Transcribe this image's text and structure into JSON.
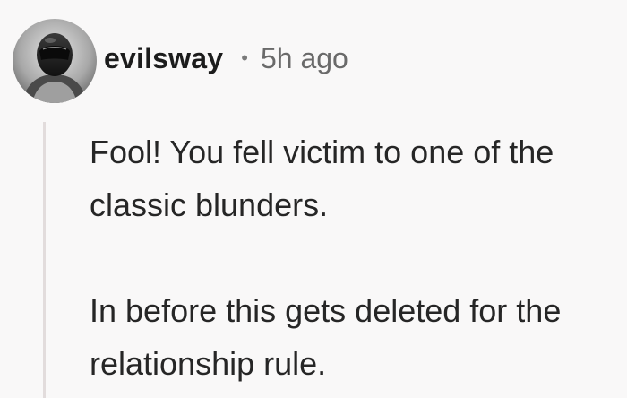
{
  "comment": {
    "username": "evilsway",
    "separator": "•",
    "timestamp": "5h ago",
    "avatar_icon": "helmet-avatar-icon",
    "paragraphs": [
      "Fool! You fell victim to one of the classic blunders.",
      "In before this gets deleted for the relationship rule."
    ]
  },
  "colors": {
    "background": "#f9f8f8",
    "text": "#262626",
    "muted": "#6a6a6a",
    "thread_line": "#e2dcdc"
  }
}
